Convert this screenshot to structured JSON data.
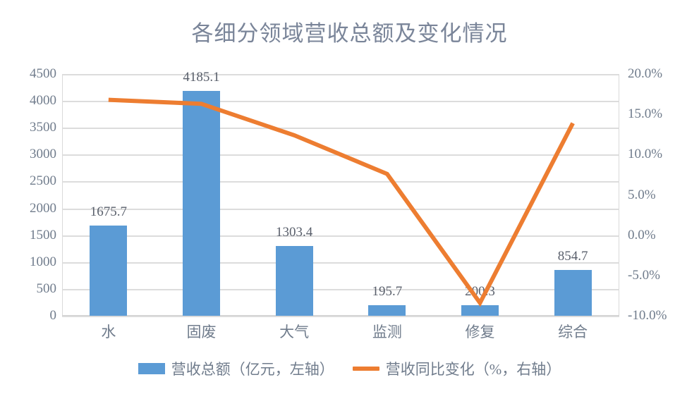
{
  "chart_data": {
    "type": "bar",
    "title": "各细分领域营收总额及变化情况",
    "xlabel": "",
    "ylabel": "",
    "grid": true,
    "legend_position": "bottom",
    "categories": [
      "水",
      "固废",
      "大气",
      "监测",
      "修复",
      "综合"
    ],
    "series": [
      {
        "name": "营收总额（亿元，左轴）",
        "type": "bar",
        "axis": "left",
        "color": "#5B9BD5",
        "values": [
          1675.7,
          4185.1,
          1303.4,
          195.7,
          200.3,
          854.7
        ],
        "labels": [
          "1675.7",
          "4185.1",
          "1303.4",
          "195.7",
          "200.3",
          "854.7"
        ]
      },
      {
        "name": "营收同比变化（%，右轴）",
        "type": "line",
        "axis": "right",
        "color": "#ED7D31",
        "values": [
          16.8,
          16.3,
          12.4,
          7.6,
          -8.4,
          13.9
        ]
      }
    ],
    "left_axis": {
      "ylim": [
        0,
        4500
      ],
      "ticks": [
        0,
        500,
        1000,
        1500,
        2000,
        2500,
        3000,
        3500,
        4000,
        4500
      ],
      "tick_labels": [
        "0",
        "500",
        "1000",
        "1500",
        "2000",
        "2500",
        "3000",
        "3500",
        "4000",
        "4500"
      ]
    },
    "right_axis": {
      "ylim": [
        -10,
        20
      ],
      "ticks": [
        -10,
        -5,
        0,
        5,
        10,
        15,
        20
      ],
      "tick_labels": [
        "-10.0%",
        "-5.0%",
        "0.0%",
        "5.0%",
        "10.0%",
        "15.0%",
        "20.0%"
      ]
    }
  },
  "colors": {
    "bar": "#5B9BD5",
    "line": "#ED7D31",
    "grid": "#DCDCDC",
    "text": "#707C8C",
    "title": "#7A8599",
    "background": "#FFFFFF"
  },
  "legend": {
    "items": [
      {
        "label": "营收总额（亿元，左轴）",
        "marker": "bar-swatch"
      },
      {
        "label": "营收同比变化（%，右轴）",
        "marker": "line-swatch"
      }
    ]
  }
}
